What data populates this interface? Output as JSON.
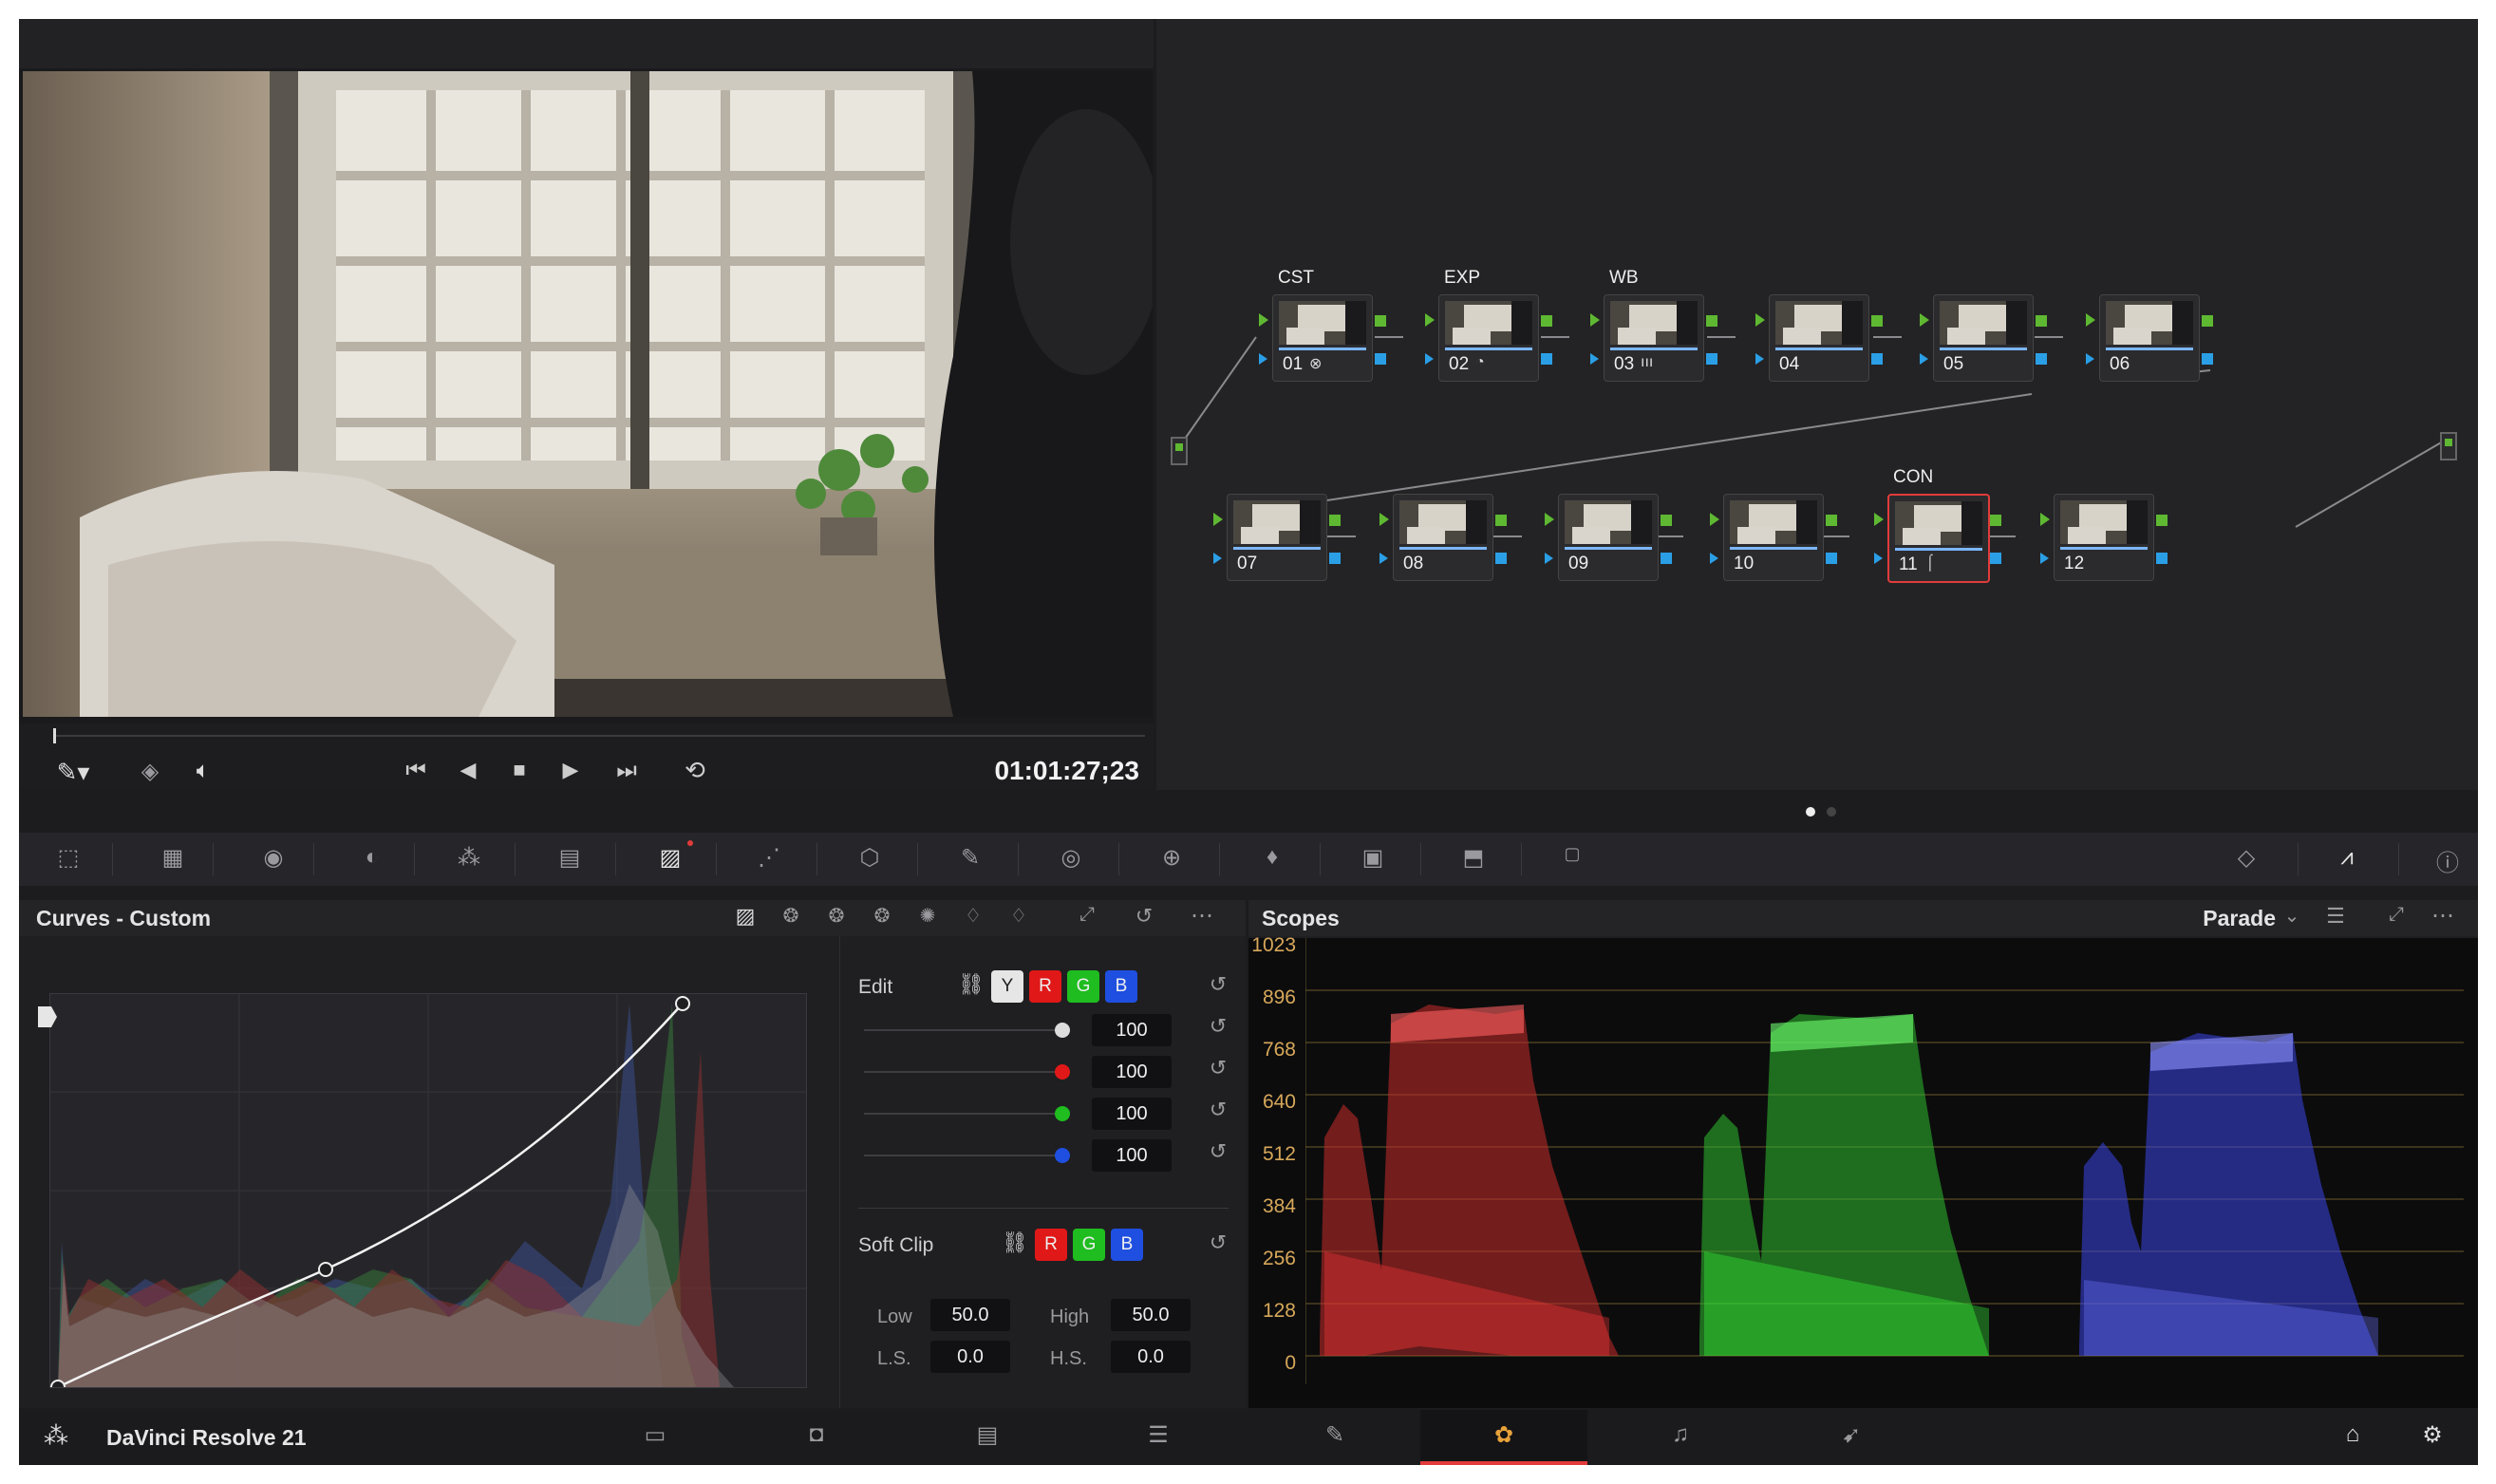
{
  "viewer": {
    "timecode": "01:01:27;23"
  },
  "nodes": {
    "row1": [
      {
        "num": "01",
        "label": "CST",
        "glyph": "⊗"
      },
      {
        "num": "02",
        "label": "EXP",
        "glyph": "◔"
      },
      {
        "num": "03",
        "label": "WB",
        "glyph": "ııı"
      },
      {
        "num": "04",
        "label": "",
        "glyph": ""
      },
      {
        "num": "05",
        "label": "",
        "glyph": ""
      },
      {
        "num": "06",
        "label": "",
        "glyph": ""
      }
    ],
    "row2": [
      {
        "num": "07",
        "label": "",
        "glyph": ""
      },
      {
        "num": "08",
        "label": "",
        "glyph": ""
      },
      {
        "num": "09",
        "label": "",
        "glyph": ""
      },
      {
        "num": "10",
        "label": "",
        "glyph": ""
      },
      {
        "num": "11",
        "label": "CON",
        "glyph": "⌠"
      },
      {
        "num": "12",
        "label": "",
        "glyph": ""
      }
    ]
  },
  "curves": {
    "title": "Curves - Custom",
    "edit_label": "Edit",
    "channels": [
      "Y",
      "R",
      "G",
      "B"
    ],
    "intensity": {
      "y": "100",
      "r": "100",
      "g": "100",
      "b": "100"
    },
    "softclip_label": "Soft Clip",
    "softclip_channels": [
      "R",
      "G",
      "B"
    ],
    "low_label": "Low",
    "low_value": "50.0",
    "high_label": "High",
    "high_value": "50.0",
    "ls_label": "L.S.",
    "ls_value": "0.0",
    "hs_label": "H.S.",
    "hs_value": "0.0"
  },
  "scopes": {
    "title": "Scopes",
    "mode": "Parade",
    "scale": [
      "1023",
      "896",
      "768",
      "640",
      "512",
      "384",
      "256",
      "128",
      "0"
    ]
  },
  "footer": {
    "app_name": "DaVinci Resolve 21"
  },
  "colors": {
    "red": "#e01818",
    "green": "#1fbd1f",
    "blue": "#1f4fe0",
    "accent": "#e23b3b"
  }
}
